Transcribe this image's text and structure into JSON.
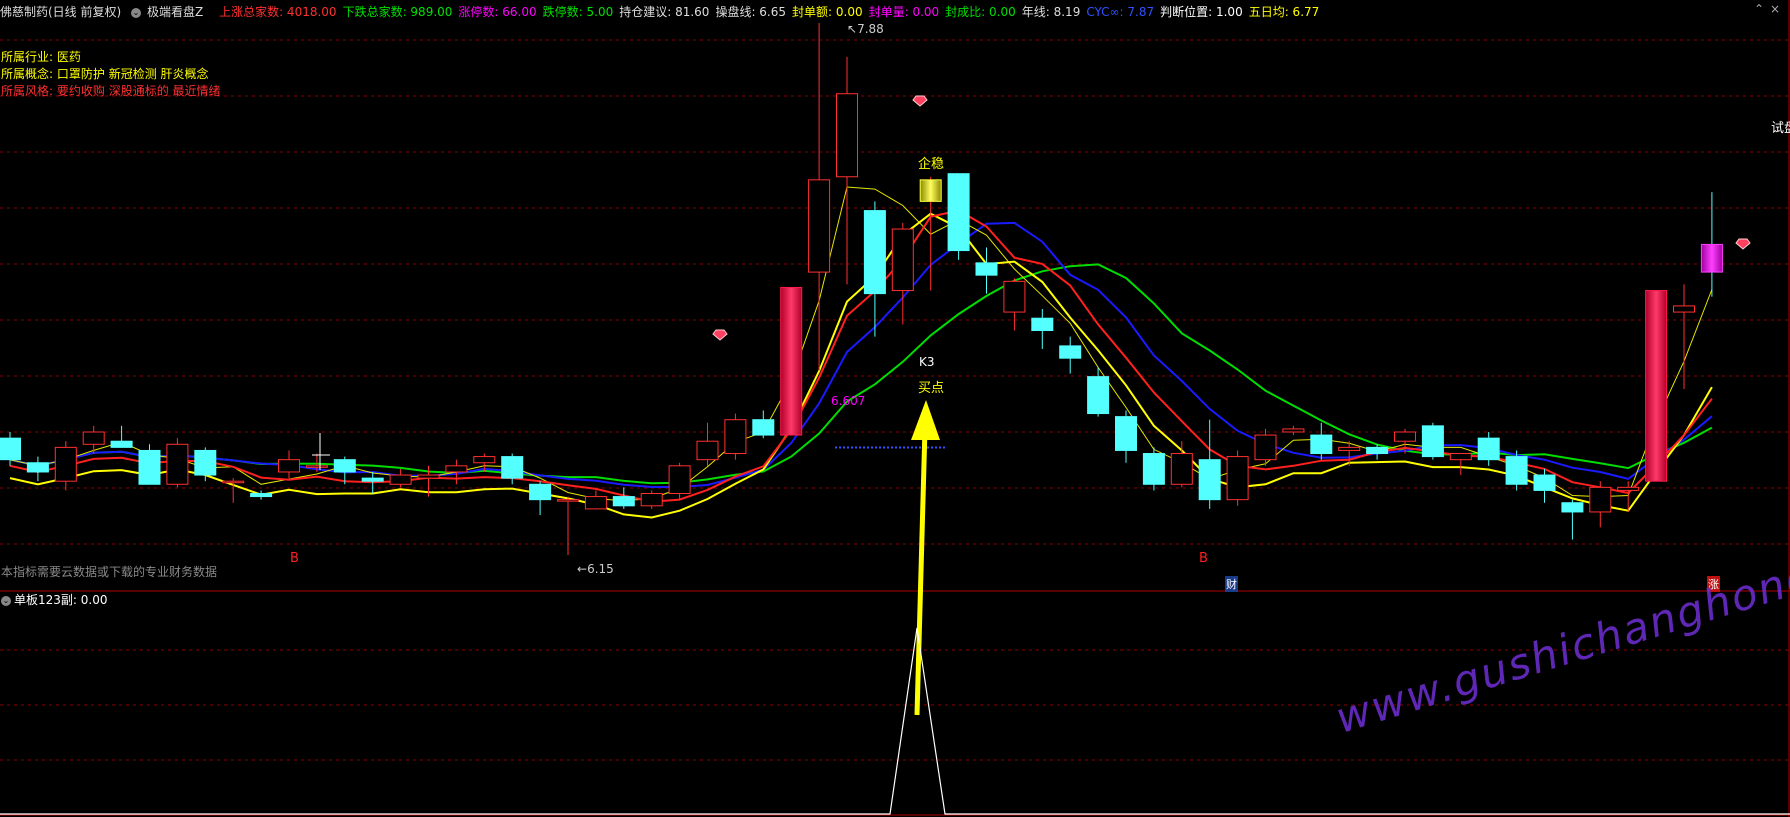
{
  "header": {
    "stock_name": "佛慈制药(日线 前复权)",
    "indicator_name": "极端看盘Z",
    "items": [
      {
        "label": "上涨总家数:",
        "value": "4018.00",
        "color": "#ff3030"
      },
      {
        "label": "下跌总家数:",
        "value": "989.00",
        "color": "#00e000"
      },
      {
        "label": "涨停数:",
        "value": "66.00",
        "color": "#ff00ff"
      },
      {
        "label": "跌停数:",
        "value": "5.00",
        "color": "#00e000"
      },
      {
        "label": "持仓建议:",
        "value": "81.60",
        "color": "#dddddd"
      },
      {
        "label": "操盘线:",
        "value": "6.65",
        "color": "#dddddd"
      },
      {
        "label": "封单额:",
        "value": "0.00",
        "color": "#ffff00"
      },
      {
        "label": "封单量:",
        "value": "0.00",
        "color": "#ff00ff"
      },
      {
        "label": "封成比:",
        "value": "0.00",
        "color": "#00e000"
      },
      {
        "label": "年线:",
        "value": "8.19",
        "color": "#dddddd"
      },
      {
        "label": "CYC∞:",
        "value": "7.87",
        "color": "#3050ff"
      },
      {
        "label": "判断位置:",
        "value": "1.00",
        "color": "#ffffff"
      },
      {
        "label": "五日均:",
        "value": "6.77",
        "color": "#ffff00"
      }
    ]
  },
  "info": {
    "industry_label": "所属行业:",
    "industry_value": "医药",
    "concept_label": "所属概念:",
    "concept_value": "口罩防护 新冠检测 肝炎概念",
    "style_label": "所属风格:",
    "style_value": "要约收购 深股通标的 最近情绪"
  },
  "annotations": {
    "high_price": "7.88",
    "low_price": "6.15",
    "level_price": "6.607",
    "stable": "企稳",
    "k3": "K3",
    "buy_point": "买点",
    "try": "试盘",
    "b_mark": "B",
    "fin_mark": "财",
    "rise_mark": "涨",
    "data_note": "本指标需要云数据或下载的专业财务数据"
  },
  "sub_panel": {
    "name": "单板123副",
    "value": ": 0.00"
  },
  "watermark": "www.gushichanghong.com",
  "colors": {
    "up": "#ff3030",
    "down": "#54ffff",
    "limit_up": "#ff1a4a",
    "ma_red": "#ff2020",
    "ma_yellow": "#ffff00",
    "ma_thin_yellow": "#e6e600",
    "ma_blue": "#1a1aff",
    "ma_green": "#00dd00",
    "grid": "#8b0000"
  },
  "chart_data": {
    "type": "candlestick",
    "candles": [
      {
        "o": 6.53,
        "h": 6.55,
        "l": 6.44,
        "c": 6.46
      },
      {
        "o": 6.45,
        "h": 6.47,
        "l": 6.39,
        "c": 6.42
      },
      {
        "o": 6.39,
        "h": 6.52,
        "l": 6.36,
        "c": 6.5
      },
      {
        "o": 6.51,
        "h": 6.57,
        "l": 6.48,
        "c": 6.55
      },
      {
        "o": 6.52,
        "h": 6.57,
        "l": 6.5,
        "c": 6.5
      },
      {
        "o": 6.49,
        "h": 6.51,
        "l": 6.38,
        "c": 6.38
      },
      {
        "o": 6.38,
        "h": 6.53,
        "l": 6.37,
        "c": 6.51
      },
      {
        "o": 6.49,
        "h": 6.5,
        "l": 6.39,
        "c": 6.41
      },
      {
        "o": 6.39,
        "h": 6.4,
        "l": 6.32,
        "c": 6.39
      },
      {
        "o": 6.35,
        "h": 6.36,
        "l": 6.33,
        "c": 6.34
      },
      {
        "o": 6.42,
        "h": 6.49,
        "l": 6.4,
        "c": 6.46
      },
      {
        "o": 6.44,
        "h": 6.48,
        "l": 6.42,
        "c": 6.44
      },
      {
        "o": 6.46,
        "h": 6.47,
        "l": 6.38,
        "c": 6.42
      },
      {
        "o": 6.4,
        "h": 6.42,
        "l": 6.35,
        "c": 6.39
      },
      {
        "o": 6.38,
        "h": 6.43,
        "l": 6.37,
        "c": 6.41
      },
      {
        "o": 6.4,
        "h": 6.44,
        "l": 6.34,
        "c": 6.41
      },
      {
        "o": 6.42,
        "h": 6.46,
        "l": 6.38,
        "c": 6.44
      },
      {
        "o": 6.45,
        "h": 6.48,
        "l": 6.42,
        "c": 6.47
      },
      {
        "o": 6.47,
        "h": 6.48,
        "l": 6.38,
        "c": 6.4
      },
      {
        "o": 6.38,
        "h": 6.39,
        "l": 6.28,
        "c": 6.33
      },
      {
        "o": 6.33,
        "h": 6.34,
        "l": 6.15,
        "c": 6.33
      },
      {
        "o": 6.3,
        "h": 6.36,
        "l": 6.3,
        "c": 6.34
      },
      {
        "o": 6.34,
        "h": 6.37,
        "l": 6.3,
        "c": 6.31
      },
      {
        "o": 6.31,
        "h": 6.36,
        "l": 6.3,
        "c": 6.35
      },
      {
        "o": 6.35,
        "h": 6.45,
        "l": 6.33,
        "c": 6.44
      },
      {
        "o": 6.46,
        "h": 6.58,
        "l": 6.44,
        "c": 6.52
      },
      {
        "o": 6.48,
        "h": 6.61,
        "l": 6.46,
        "c": 6.59
      },
      {
        "o": 6.59,
        "h": 6.62,
        "l": 6.53,
        "c": 6.54
      },
      {
        "o": 6.54,
        "h": 7.02,
        "l": 6.54,
        "c": 7.02
      },
      {
        "o": 7.07,
        "h": 7.88,
        "l": 6.75,
        "c": 7.37
      },
      {
        "o": 7.38,
        "h": 7.77,
        "l": 7.03,
        "c": 7.65
      },
      {
        "o": 7.27,
        "h": 7.3,
        "l": 6.86,
        "c": 7.0
      },
      {
        "o": 7.01,
        "h": 7.23,
        "l": 6.9,
        "c": 7.21
      },
      {
        "o": 7.3,
        "h": 7.38,
        "l": 7.01,
        "c": 7.37
      },
      {
        "o": 7.39,
        "h": 7.39,
        "l": 7.11,
        "c": 7.14
      },
      {
        "o": 7.1,
        "h": 7.15,
        "l": 7.0,
        "c": 7.06
      },
      {
        "o": 6.94,
        "h": 7.05,
        "l": 6.88,
        "c": 7.04
      },
      {
        "o": 6.92,
        "h": 6.95,
        "l": 6.82,
        "c": 6.88
      },
      {
        "o": 6.83,
        "h": 6.86,
        "l": 6.74,
        "c": 6.79
      },
      {
        "o": 6.73,
        "h": 6.76,
        "l": 6.6,
        "c": 6.61
      },
      {
        "o": 6.6,
        "h": 6.62,
        "l": 6.45,
        "c": 6.49
      },
      {
        "o": 6.48,
        "h": 6.5,
        "l": 6.36,
        "c": 6.38
      },
      {
        "o": 6.38,
        "h": 6.52,
        "l": 6.37,
        "c": 6.48
      },
      {
        "o": 6.46,
        "h": 6.59,
        "l": 6.3,
        "c": 6.33
      },
      {
        "o": 6.33,
        "h": 6.49,
        "l": 6.31,
        "c": 6.47
      },
      {
        "o": 6.46,
        "h": 6.56,
        "l": 6.44,
        "c": 6.54
      },
      {
        "o": 6.55,
        "h": 6.57,
        "l": 6.54,
        "c": 6.56
      },
      {
        "o": 6.54,
        "h": 6.58,
        "l": 6.46,
        "c": 6.48
      },
      {
        "o": 6.49,
        "h": 6.52,
        "l": 6.44,
        "c": 6.5
      },
      {
        "o": 6.5,
        "h": 6.51,
        "l": 6.46,
        "c": 6.48
      },
      {
        "o": 6.52,
        "h": 6.56,
        "l": 6.48,
        "c": 6.55
      },
      {
        "o": 6.57,
        "h": 6.58,
        "l": 6.46,
        "c": 6.47
      },
      {
        "o": 6.46,
        "h": 6.48,
        "l": 6.41,
        "c": 6.48
      },
      {
        "o": 6.53,
        "h": 6.55,
        "l": 6.44,
        "c": 6.46
      },
      {
        "o": 6.47,
        "h": 6.49,
        "l": 6.36,
        "c": 6.38
      },
      {
        "o": 6.41,
        "h": 6.43,
        "l": 6.32,
        "c": 6.36
      },
      {
        "o": 6.32,
        "h": 6.33,
        "l": 6.2,
        "c": 6.29
      },
      {
        "o": 6.29,
        "h": 6.39,
        "l": 6.24,
        "c": 6.37
      },
      {
        "o": 6.36,
        "h": 6.39,
        "l": 6.29,
        "c": 6.37
      },
      {
        "o": 6.39,
        "h": 7.01,
        "l": 6.39,
        "c": 7.01
      },
      {
        "o": 6.94,
        "h": 7.03,
        "l": 6.69,
        "c": 6.96
      },
      {
        "o": 7.16,
        "h": 7.33,
        "l": 6.99,
        "c": 7.07
      }
    ],
    "limit_up_index": [
      28,
      59
    ],
    "doji_index": [
      33
    ],
    "purple_index": [
      61
    ]
  }
}
